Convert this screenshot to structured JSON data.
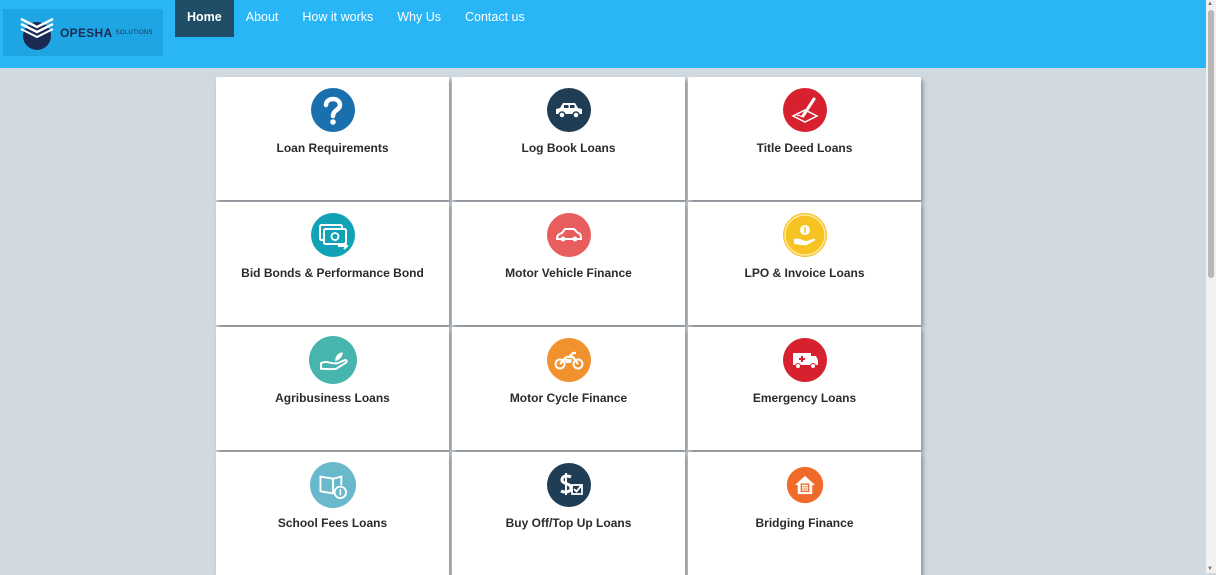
{
  "brand": {
    "name": "OPESHA",
    "subtitle": "SOLUTIONS"
  },
  "nav": {
    "items": [
      {
        "label": "Home",
        "active": true
      },
      {
        "label": "About"
      },
      {
        "label": "How it works"
      },
      {
        "label": "Why Us"
      },
      {
        "label": "Contact us"
      }
    ]
  },
  "cards": [
    {
      "label": "Loan Requirements",
      "icon": "question-icon",
      "color": "#1a6fae"
    },
    {
      "label": "Log Book Loans",
      "icon": "car-icon",
      "color": "#1f3d55"
    },
    {
      "label": "Title Deed Loans",
      "icon": "signature-icon",
      "color": "#d8212f"
    },
    {
      "label": "Bid Bonds & Performance Bond",
      "icon": "money-transfer-icon",
      "color": "#11a3b5"
    },
    {
      "label": "Motor Vehicle Finance",
      "icon": "car-icon",
      "color": "#e85d5d"
    },
    {
      "label": "LPO & Invoice Loans",
      "icon": "hand-coin-icon",
      "color": "#f7c323"
    },
    {
      "label": "Agribusiness Loans",
      "icon": "hand-sprout-icon",
      "color": "#45b5ad"
    },
    {
      "label": "Motor Cycle Finance",
      "icon": "motorcycle-icon",
      "color": "#f2922e"
    },
    {
      "label": "Emergency Loans",
      "icon": "ambulance-icon",
      "color": "#d8212f"
    },
    {
      "label": "School Fees Loans",
      "icon": "book-coin-icon",
      "color": "#6ab8cb"
    },
    {
      "label": "Buy Off/Top Up Loans",
      "icon": "dollar-check-icon",
      "color": "#1f3d55"
    },
    {
      "label": "Bridging Finance",
      "icon": "house-icon",
      "color": "#f06a2a"
    }
  ]
}
